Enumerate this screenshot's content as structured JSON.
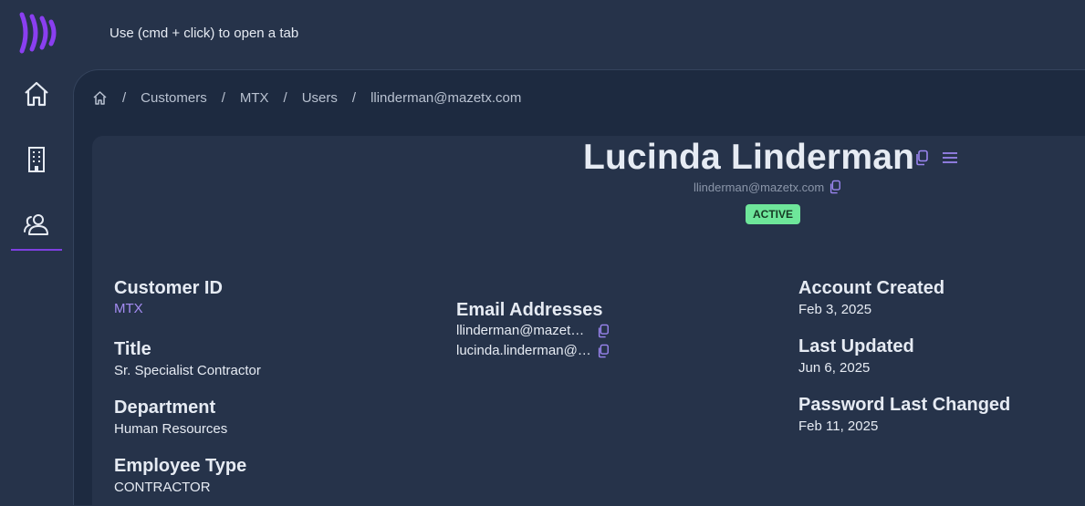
{
  "topbar": {
    "hint": "Use (cmd + click) to open a tab"
  },
  "sidebar": {
    "items": [
      {
        "icon": "home-icon"
      },
      {
        "icon": "building-icon"
      },
      {
        "icon": "users-icon",
        "active": true
      }
    ],
    "accent": "#7e3fe0"
  },
  "breadcrumb": {
    "items": [
      "Customers",
      "MTX",
      "Users",
      "llinderman@mazetx.com"
    ],
    "separator": "/"
  },
  "user": {
    "name": "Lucinda Linderman",
    "email": "llinderman@mazetx.com",
    "status": "ACTIVE"
  },
  "fields": {
    "customer_id": {
      "label": "Customer ID",
      "value": "MTX"
    },
    "title": {
      "label": "Title",
      "value": "Sr. Specialist Contractor"
    },
    "department": {
      "label": "Department",
      "value": "Human Resources"
    },
    "employee_type": {
      "label": "Employee Type",
      "value": "CONTRACTOR"
    },
    "email_addresses": {
      "label": "Email Addresses",
      "values": [
        "llinderman@mazetx.com",
        "lucinda.linderman@mazetx.com"
      ],
      "display": [
        "llinderman@mazet…",
        "lucinda.linderman@…"
      ]
    },
    "account_created": {
      "label": "Account Created",
      "value": "Feb 3, 2025"
    },
    "last_updated": {
      "label": "Last Updated",
      "value": "Jun 6, 2025"
    },
    "password_last_changed": {
      "label": "Password Last Changed",
      "value": "Feb 11, 2025"
    }
  },
  "colors": {
    "background": "#26334a",
    "content": "#1d2a40",
    "accent": "#7e3fe0",
    "link": "#a48cf2",
    "badge": "#6ee69a"
  }
}
